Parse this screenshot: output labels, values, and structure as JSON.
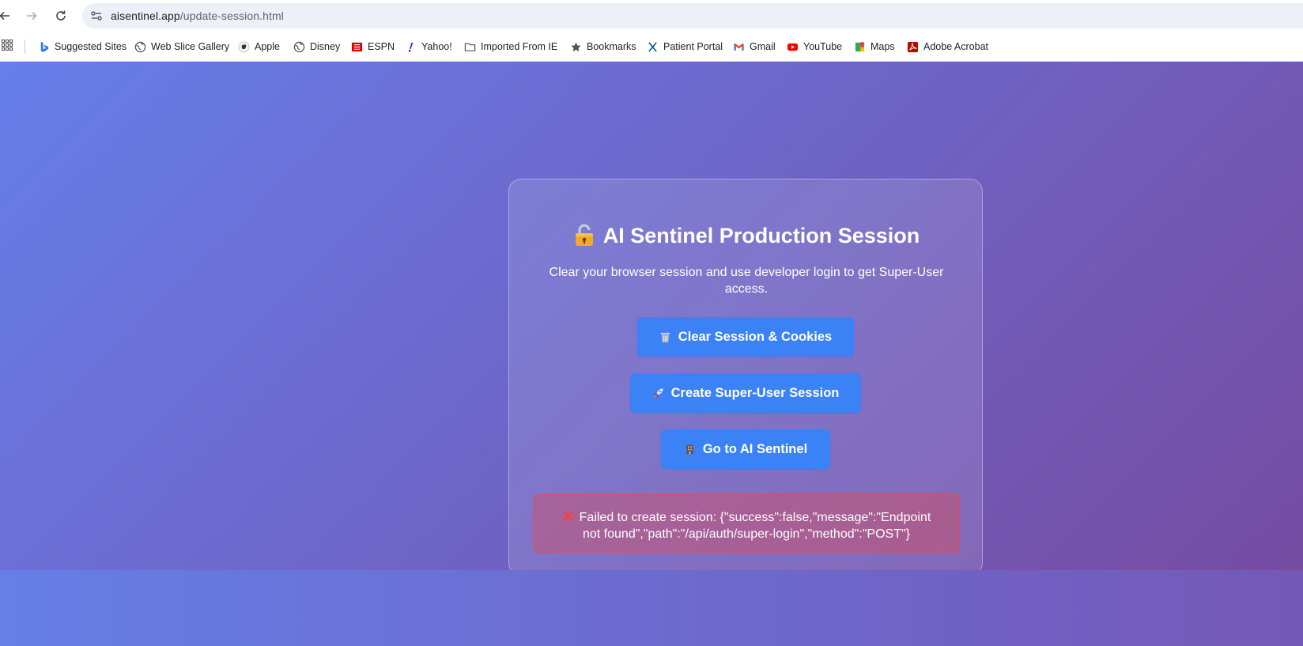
{
  "browser": {
    "url_host": "aisentinel.app",
    "url_path": "/update-session.html"
  },
  "bookmarks": [
    {
      "label": "Suggested Sites",
      "icon": "bing-icon"
    },
    {
      "label": "Web Slice Gallery",
      "icon": "globe-icon"
    },
    {
      "label": "Apple",
      "icon": "apple-icon"
    },
    {
      "label": "Disney",
      "icon": "globe-icon"
    },
    {
      "label": "ESPN",
      "icon": "espn-icon"
    },
    {
      "label": "Yahoo!",
      "icon": "yahoo-icon"
    },
    {
      "label": "Imported From IE",
      "icon": "folder-icon"
    },
    {
      "label": "Bookmarks",
      "icon": "star-icon"
    },
    {
      "label": "Patient Portal",
      "icon": "x-logo-icon"
    },
    {
      "label": "Gmail",
      "icon": "gmail-icon"
    },
    {
      "label": "YouTube",
      "icon": "youtube-icon"
    },
    {
      "label": "Maps",
      "icon": "maps-icon"
    },
    {
      "label": "Adobe Acrobat",
      "icon": "acrobat-icon"
    }
  ],
  "card": {
    "title": "AI Sentinel Production Session",
    "title_icon": "lock-icon",
    "subtitle": "Clear your browser session and use developer login to get Super-User access.",
    "buttons": {
      "clear": {
        "label": "Clear Session & Cookies",
        "icon": "wastebasket-icon"
      },
      "create": {
        "label": "Create Super-User Session",
        "icon": "rocket-icon"
      },
      "go": {
        "label": "Go to AI Sentinel",
        "icon": "building-icon"
      }
    },
    "error": {
      "icon": "cross-mark-icon",
      "text": "Failed to create session: {\"success\":false,\"message\":\"Endpoint not found\",\"path\":\"/api/auth/super-login\",\"method\":\"POST\"}"
    }
  },
  "colors": {
    "gradient_start": "#667eea",
    "gradient_end": "#764ba2",
    "button": "#3b82f6",
    "error_tint": "#ef4444"
  }
}
